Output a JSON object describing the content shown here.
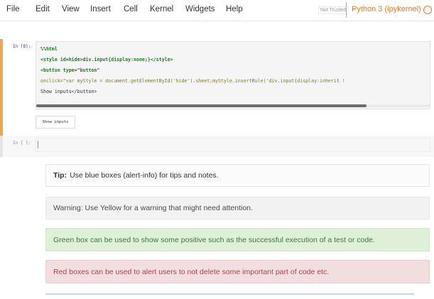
{
  "menu": {
    "items": [
      "File",
      "Edit",
      "View",
      "Insert",
      "Cell",
      "Kernel",
      "Widgets",
      "Help"
    ],
    "trust_status": "Not Trusted",
    "kernel_name": "Python 3 (ipykernel)"
  },
  "cells": {
    "code_cell": {
      "prompt": "In [8]:",
      "lines": [
        "%%html",
        "<style id=hide>div.input{display:none;}</style>",
        "<button type=\"button\"",
        "onclick=\"var myStyle = document.getElementById('hide').sheet;myStyle.insertRule('div.input{display:inherit !",
        "Show inputs</button>"
      ],
      "output_button": "Show inputs"
    },
    "empty_cell": {
      "prompt": "In [ ]:"
    }
  },
  "alerts": {
    "info": {
      "label": "Tip:",
      "text": "Use blue boxes (alert-info) for tips and notes."
    },
    "warning": {
      "text": "Warning: Use Yellow for a warning that might need attention."
    },
    "success": {
      "text": "Green box can be used to show some positive such as the successful execution of a test or code."
    },
    "danger": {
      "text": "Red boxes can be used to alert users to not delete some important part of code etc."
    }
  },
  "colors": {
    "kernel_accent": "#f07a1f",
    "edit_mode_border": "#f0a54a",
    "success_bg": "#dff0d8",
    "danger_bg": "#f2dede",
    "warning_bg": "#f2f2f2"
  },
  "icons": {
    "kernel_indicator": "circle-outline-icon"
  }
}
